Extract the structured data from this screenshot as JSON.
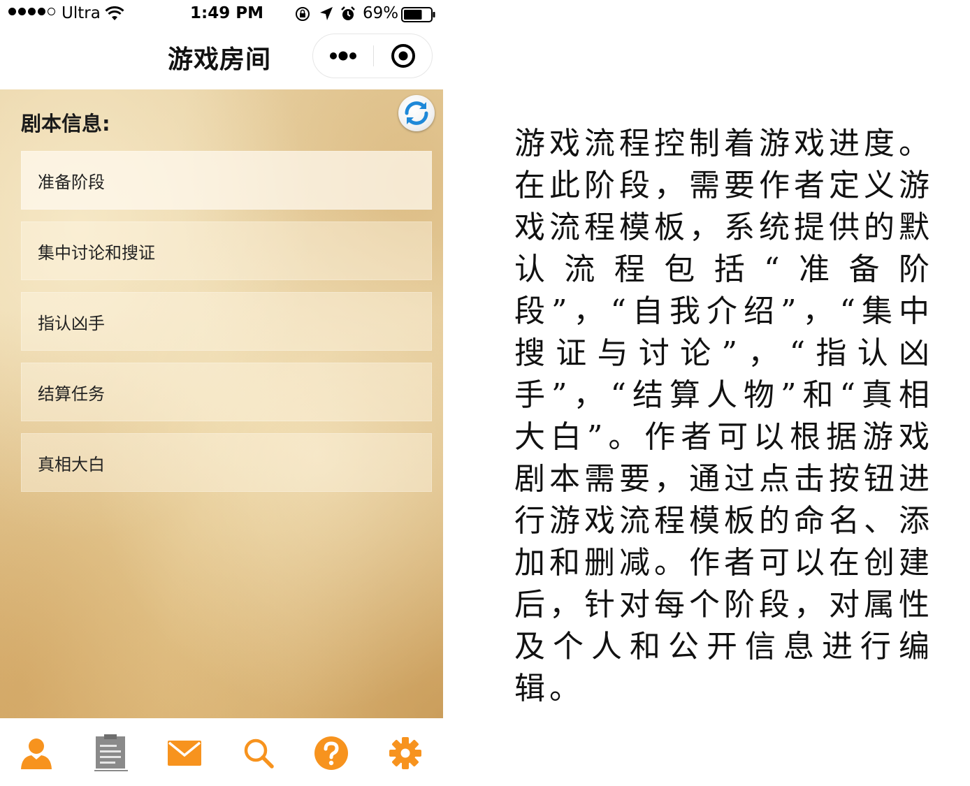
{
  "status_bar": {
    "carrier": "Ultra",
    "time": "1:49 PM",
    "battery_percent": "69%",
    "signal_bars": 4,
    "signal_max": 5,
    "battery_level": 0.69
  },
  "nav": {
    "title": "游戏房间",
    "more_icon": "more-dots-icon",
    "close_icon": "target-close-icon"
  },
  "content": {
    "section_title": "剧本信息:",
    "refresh_icon": "refresh-icon",
    "stages": [
      {
        "label": "准备阶段"
      },
      {
        "label": "集中讨论和搜证"
      },
      {
        "label": "指认凶手"
      },
      {
        "label": "结算任务"
      },
      {
        "label": "真相大白"
      }
    ]
  },
  "tab_bar": {
    "accent_color": "#f7931e",
    "inactive_color": "#8a8a8a",
    "tabs": [
      {
        "icon": "user-icon"
      },
      {
        "icon": "notepad-icon"
      },
      {
        "icon": "mail-icon"
      },
      {
        "icon": "search-icon"
      },
      {
        "icon": "help-icon"
      },
      {
        "icon": "gear-icon"
      }
    ]
  },
  "description": {
    "text": "游戏流程控制着游戏进度。在此阶段，需要作者定义游戏流程模板，系统提供的默认流程包括“准备阶段”，“自我介绍”，“集中搜证与讨论”，“指认凶手”，“结算人物”和“真相大白”。作者可以根据游戏剧本需要，通过点击按钮进行游戏流程模板的命名、添加和删减。作者可以在创建后，针对每个阶段，对属性及个人和公开信息进行编辑。"
  }
}
